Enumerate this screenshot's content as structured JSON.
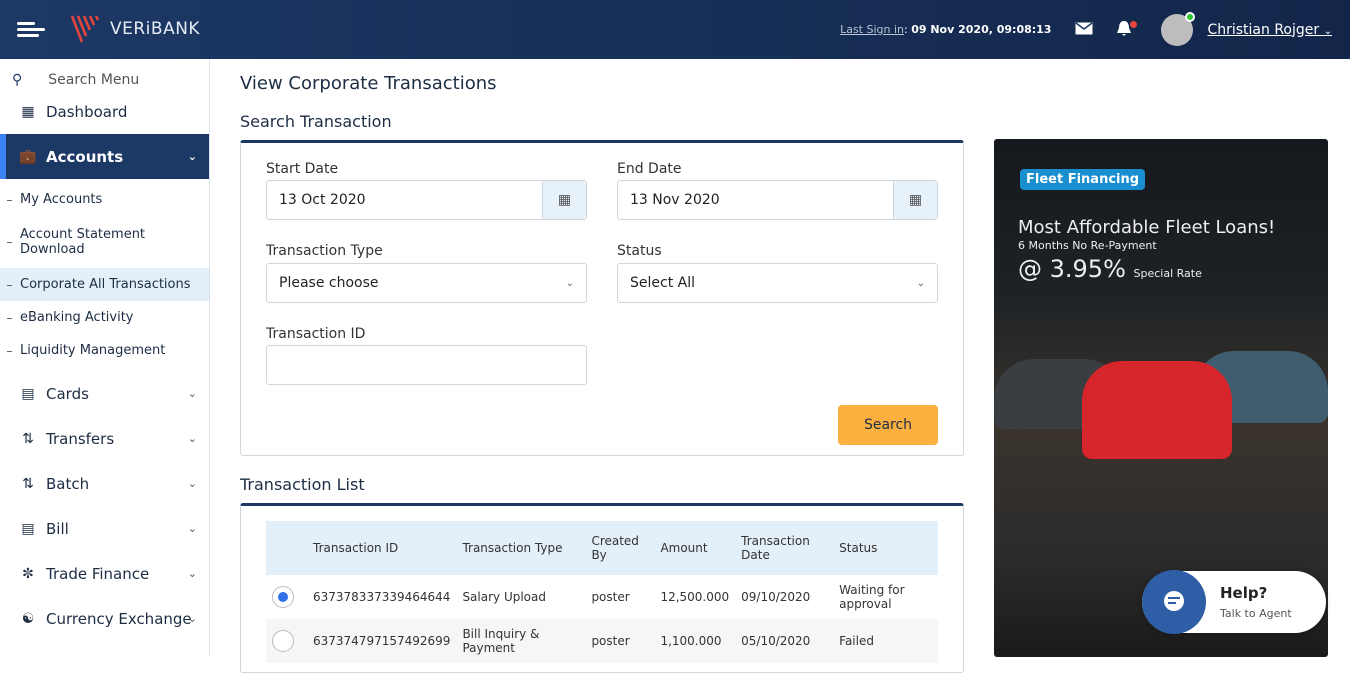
{
  "header": {
    "brand": "VERiBANK",
    "last_signin_label": "Last Sign in",
    "last_signin_value": "09 Nov 2020, 09:08:13",
    "user_name": "Christian Rojger"
  },
  "sidebar": {
    "search_placeholder": "Search Menu",
    "items": [
      {
        "label": "Dashboard",
        "icon": "dashboard-icon"
      },
      {
        "label": "Accounts",
        "icon": "briefcase-icon",
        "active": true,
        "sub": [
          {
            "label": "My Accounts"
          },
          {
            "label": "Account Statement Download"
          },
          {
            "label": "Corporate All Transactions",
            "selected": true
          },
          {
            "label": "eBanking Activity"
          },
          {
            "label": "Liquidity Management"
          }
        ]
      },
      {
        "label": "Cards",
        "icon": "card-icon"
      },
      {
        "label": "Transfers",
        "icon": "transfer-icon"
      },
      {
        "label": "Batch",
        "icon": "batch-icon"
      },
      {
        "label": "Bill",
        "icon": "bill-icon"
      },
      {
        "label": "Trade Finance",
        "icon": "globe-icon"
      },
      {
        "label": "Currency Exchange",
        "icon": "currency-icon"
      }
    ]
  },
  "page": {
    "title": "View Corporate Transactions",
    "search_title": "Search Transaction",
    "list_title": "Transaction List"
  },
  "form": {
    "start_date_label": "Start Date",
    "start_date": "13 Oct 2020",
    "end_date_label": "End Date",
    "end_date": "13 Nov 2020",
    "type_label": "Transaction Type",
    "type_value": "Please choose",
    "status_label": "Status",
    "status_value": "Select All",
    "id_label": "Transaction ID",
    "id_value": "",
    "search_button": "Search"
  },
  "table": {
    "headers": [
      "Transaction ID",
      "Transaction Type",
      "Created By",
      "Amount",
      "Transaction Date",
      "Status"
    ],
    "rows": [
      {
        "selected": true,
        "id": "637378337339464644",
        "type": "Salary Upload",
        "by": "poster",
        "amount": "12,500.000",
        "date": "09/10/2020",
        "status": "Waiting for approval"
      },
      {
        "selected": false,
        "id": "637374797157492699",
        "type": "Bill Inquiry & Payment",
        "by": "poster",
        "amount": "1,100.000",
        "date": "05/10/2020",
        "status": "Failed"
      }
    ]
  },
  "ad": {
    "badge": "Fleet Financing",
    "headline": "Most Affordable Fleet Loans!",
    "subline": "6 Months No Re-Payment",
    "rate": "@ 3.95%",
    "rate_note": "Special Rate"
  },
  "help": {
    "title": "Help?",
    "subtitle": "Talk to Agent"
  }
}
